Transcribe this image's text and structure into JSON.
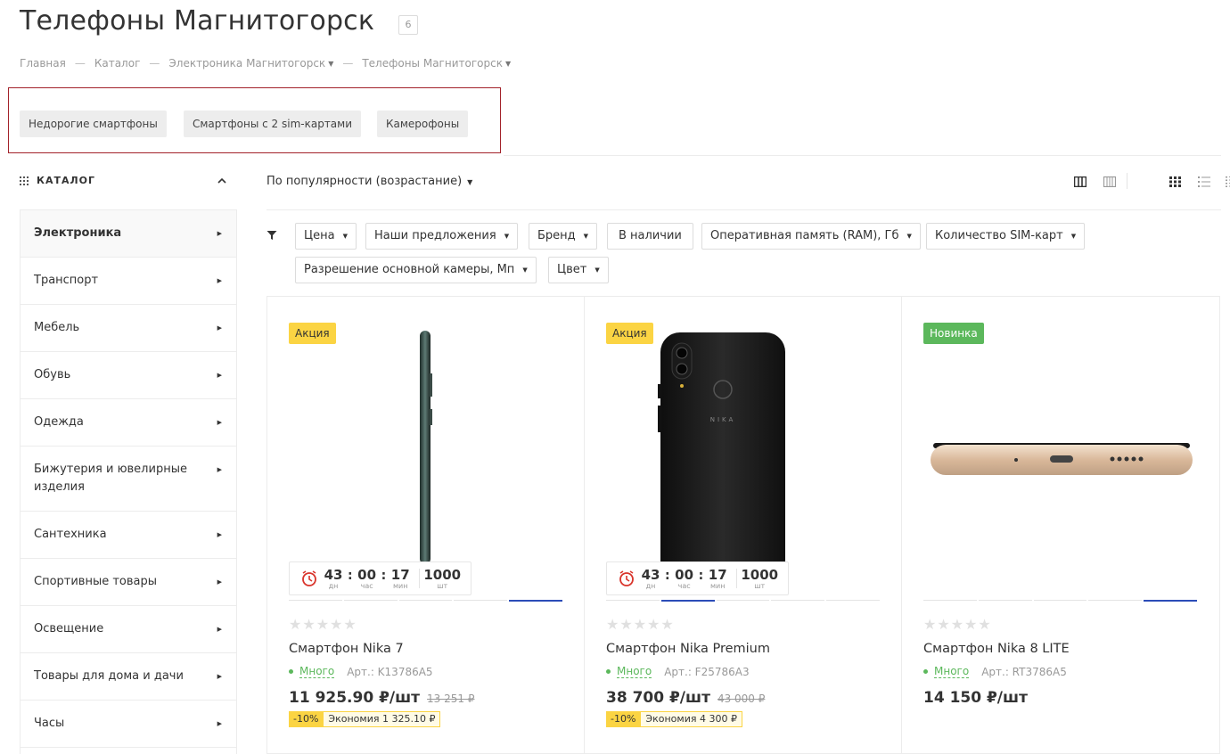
{
  "page": {
    "title": "Телефоны Магнитогорск",
    "count": "6"
  },
  "breadcrumb": [
    {
      "label": "Главная"
    },
    {
      "label": "Каталог"
    },
    {
      "label": "Электроника Магнитогорск"
    },
    {
      "label": "Телефоны Магнитогорск"
    }
  ],
  "tags": [
    "Недорогие смартфоны",
    "Смартфоны с 2 sim-картами",
    "Камерофоны"
  ],
  "catalog": {
    "heading": "КАТАЛОГ",
    "items": [
      {
        "label": "Электроника"
      },
      {
        "label": "Транспорт"
      },
      {
        "label": "Мебель"
      },
      {
        "label": "Обувь"
      },
      {
        "label": "Одежда"
      },
      {
        "label": "Бижутерия и ювелирные изделия"
      },
      {
        "label": "Сантехника"
      },
      {
        "label": "Спортивные товары"
      },
      {
        "label": "Освещение"
      },
      {
        "label": "Товары для дома и дачи"
      },
      {
        "label": "Часы"
      }
    ]
  },
  "sort": {
    "label": "По популярности (возрастание)"
  },
  "filters": [
    "Цена",
    "Наши предложения",
    "Бренд",
    "В наличии",
    "Оперативная память (RAM), Гб",
    "Количество SIM-карт",
    "Разрешение основной камеры, Мп",
    "Цвет"
  ],
  "timer_units": {
    "days": "дн",
    "hours": "час",
    "minutes": "мин",
    "pieces": "шт"
  },
  "products": [
    {
      "badge": "Акция",
      "timer": {
        "days": "43",
        "hours": "00",
        "minutes": "17",
        "pieces": "1000"
      },
      "name": "Смартфон Nika 7",
      "stock": "Много",
      "article": "Арт.: K13786A5",
      "price": "11 925.90 ₽/шт",
      "old_price": "13 251 ₽",
      "discount": "-10%",
      "economy": "Экономия 1 325.10 ₽",
      "rating": 0
    },
    {
      "badge": "Акция",
      "timer": {
        "days": "43",
        "hours": "00",
        "minutes": "17",
        "pieces": "1000"
      },
      "name": "Смартфон Nika Premium",
      "stock": "Много",
      "article": "Арт.: F25786A3",
      "price": "38 700 ₽/шт",
      "old_price": "43 000 ₽",
      "discount": "-10%",
      "economy": "Экономия 4 300 ₽",
      "rating": 0
    },
    {
      "badge": "Новинка",
      "name": "Смартфон Nika 8 LITE",
      "stock": "Много",
      "article": "Арт.: RT3786A5",
      "price": "14 150 ₽/шт",
      "rating": 0
    }
  ],
  "phone_brand_print": "NIKA",
  "colors": {
    "accent_blue": "#2c4db8",
    "sale_yellow": "#fbd443",
    "new_green": "#5cb85c",
    "highlight_red": "#a3222a"
  }
}
